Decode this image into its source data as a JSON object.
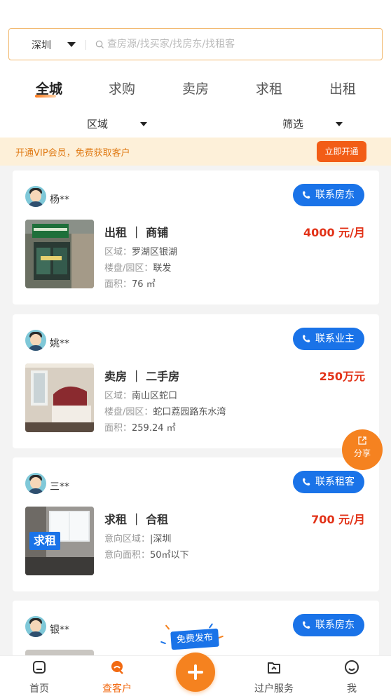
{
  "search": {
    "city": "深圳",
    "placeholder": "查房源/找买家/找房东/找租客"
  },
  "tabs": [
    "全城",
    "求购",
    "卖房",
    "求租",
    "出租"
  ],
  "active_tab": "全城",
  "filters": {
    "area": "区域",
    "filter": "筛选"
  },
  "vip": {
    "text": "开通VIP会员，免费获取客户",
    "button": "立即开通"
  },
  "cards": [
    {
      "owner": "杨**",
      "contact": "联系房东",
      "type": "出租 ｜ 商铺",
      "price": "4000 元/月",
      "lines": [
        {
          "label": "区域：",
          "value": "罗湖区银湖"
        },
        {
          "label": "楼盘/园区：",
          "value": "联发"
        },
        {
          "label": "面积：",
          "value": "76 ㎡"
        }
      ]
    },
    {
      "owner": "姚**",
      "contact": "联系业主",
      "type": "卖房 ｜ 二手房",
      "price": "250万元",
      "lines": [
        {
          "label": "区域：",
          "value": "南山区蛇口"
        },
        {
          "label": "楼盘/园区：",
          "value": "蛇口荔园路东水湾"
        },
        {
          "label": "面积：",
          "value": "259.24 ㎡"
        }
      ]
    },
    {
      "owner": "三**",
      "contact": "联系租客",
      "type": "求租 ｜ 合租",
      "price": "700 元/月",
      "thumb_tag": "求租",
      "lines": [
        {
          "label": "意向区域：",
          "value": "|深圳"
        },
        {
          "label": "意向面积：",
          "value": "50㎡以下"
        }
      ]
    },
    {
      "owner": "银**",
      "contact": "联系房东"
    }
  ],
  "share": "分享",
  "publish": "免费发布",
  "nav": [
    {
      "label": "首页",
      "icon": "home-icon"
    },
    {
      "label": "查客户",
      "icon": "search-customer-icon",
      "active": true
    },
    {
      "label": "过户服务",
      "icon": "transfer-service-icon"
    },
    {
      "label": "我",
      "icon": "profile-icon"
    }
  ],
  "colors": {
    "accent": "#f5821f",
    "price": "#e23218",
    "contact": "#1a73e8",
    "vip_bg": "#fdf0d9"
  }
}
